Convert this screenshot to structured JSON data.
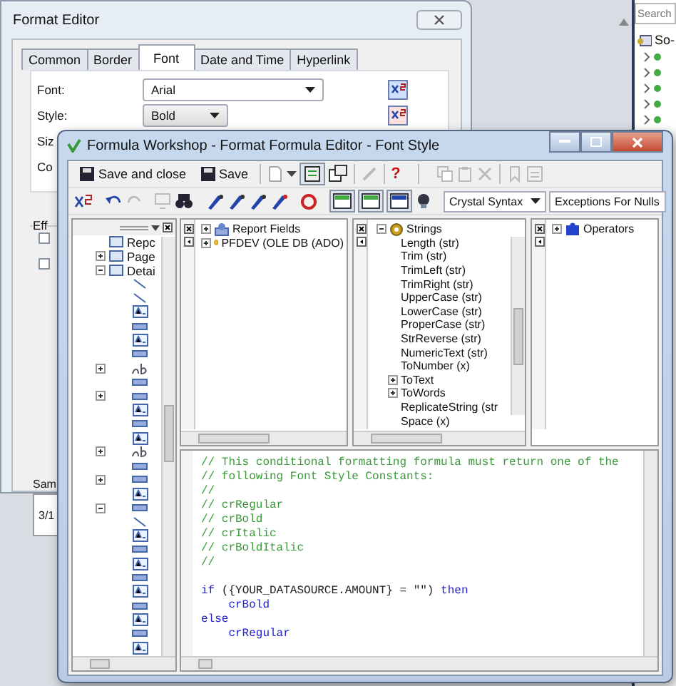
{
  "format_editor": {
    "title": "Format Editor",
    "tabs": [
      {
        "label": "Common",
        "selected": false
      },
      {
        "label": "Border",
        "selected": false
      },
      {
        "label": "Font",
        "selected": true
      },
      {
        "label": "Date and Time",
        "selected": false
      },
      {
        "label": "Hyperlink",
        "selected": false
      }
    ],
    "fields": [
      {
        "label": "Font:",
        "value": "Arial"
      },
      {
        "label": "Style:",
        "value": "Bold"
      }
    ],
    "cut_labels": [
      "Siz",
      "Co"
    ],
    "effects": {
      "label": "Eff",
      "checkboxes": [
        {
          "checked": false
        },
        {
          "checked": false
        }
      ]
    },
    "sample": {
      "label": "Sam",
      "text": "3/1"
    }
  },
  "side_panel": {
    "search_placeholder": "Search",
    "tree": [
      {
        "label": "So-"
      }
    ]
  },
  "formula_window": {
    "title": "Formula Workshop - Format Formula Editor - Font Style",
    "toolbar": {
      "buttons": [
        {
          "label": "Save and close"
        },
        {
          "label": "Save"
        }
      ],
      "help": "?"
    },
    "syntax": "Crystal Syntax",
    "nulls": "Exceptions For Nulls",
    "tree_pane": [
      {
        "kind": "section",
        "label": "Repc"
      },
      {
        "kind": "section",
        "label": "Page",
        "expanded": false
      },
      {
        "kind": "section",
        "label": "Detai",
        "expanded": true
      },
      {
        "kind": "line"
      },
      {
        "kind": "line"
      },
      {
        "kind": "field"
      },
      {
        "kind": "box"
      },
      {
        "kind": "field"
      },
      {
        "kind": "box"
      },
      {
        "kind": "text",
        "expanded": false
      },
      {
        "kind": "box"
      },
      {
        "kind": "box",
        "expanded": false
      },
      {
        "kind": "field"
      },
      {
        "kind": "box"
      },
      {
        "kind": "field"
      },
      {
        "kind": "text",
        "expanded": false
      },
      {
        "kind": "box"
      },
      {
        "kind": "box",
        "expanded": false
      },
      {
        "kind": "field"
      },
      {
        "kind": "box",
        "expanded": true
      },
      {
        "kind": "line"
      },
      {
        "kind": "field"
      },
      {
        "kind": "box"
      },
      {
        "kind": "field"
      },
      {
        "kind": "box"
      },
      {
        "kind": "field"
      },
      {
        "kind": "box"
      },
      {
        "kind": "field"
      },
      {
        "kind": "box"
      },
      {
        "kind": "field"
      }
    ],
    "fields_pane": [
      {
        "label": "Report Fields",
        "expanded": false
      },
      {
        "label": "PFDEV (OLE DB (ADO)",
        "expanded": false
      }
    ],
    "functions_pane": {
      "label": "Strings",
      "expanded": true,
      "children": [
        {
          "label": "Length (str)"
        },
        {
          "label": "Trim (str)"
        },
        {
          "label": "TrimLeft (str)"
        },
        {
          "label": "TrimRight (str)"
        },
        {
          "label": "UpperCase (str)"
        },
        {
          "label": "LowerCase (str)"
        },
        {
          "label": "ProperCase (str)"
        },
        {
          "label": "StrReverse (str)"
        },
        {
          "label": "NumericText (str)"
        },
        {
          "label": "ToNumber (x)"
        },
        {
          "label": "ToText",
          "expanded": false
        },
        {
          "label": "ToWords",
          "expanded": false
        },
        {
          "label": "ReplicateString (str"
        },
        {
          "label": "Space (x)"
        }
      ]
    },
    "operators_pane": [
      {
        "label": "Operators",
        "expanded": false
      }
    ],
    "code": [
      [
        {
          "kind": "comment",
          "text": "// This conditional formatting formula must return one of the"
        }
      ],
      [
        {
          "kind": "comment",
          "text": "// following Font Style Constants:"
        }
      ],
      [
        {
          "kind": "comment",
          "text": "//"
        }
      ],
      [
        {
          "kind": "comment",
          "text": "// crRegular"
        }
      ],
      [
        {
          "kind": "comment",
          "text": "// crBold"
        }
      ],
      [
        {
          "kind": "comment",
          "text": "// crItalic"
        }
      ],
      [
        {
          "kind": "comment",
          "text": "// crBoldItalic"
        }
      ],
      [
        {
          "kind": "comment",
          "text": "//"
        }
      ],
      [
        {
          "kind": "keyword",
          "text": "if",
          "blank_before": true
        },
        {
          "kind": "plain",
          "text": " ({YOUR_DATASOURCE.AMOUNT} = \"\") "
        },
        {
          "kind": "keyword",
          "text": "then"
        }
      ],
      [
        {
          "kind": "keyword",
          "text": "    crBold"
        }
      ],
      [
        {
          "kind": "keyword",
          "text": "else"
        }
      ],
      [
        {
          "kind": "keyword",
          "text": "    crRegular"
        }
      ]
    ]
  }
}
